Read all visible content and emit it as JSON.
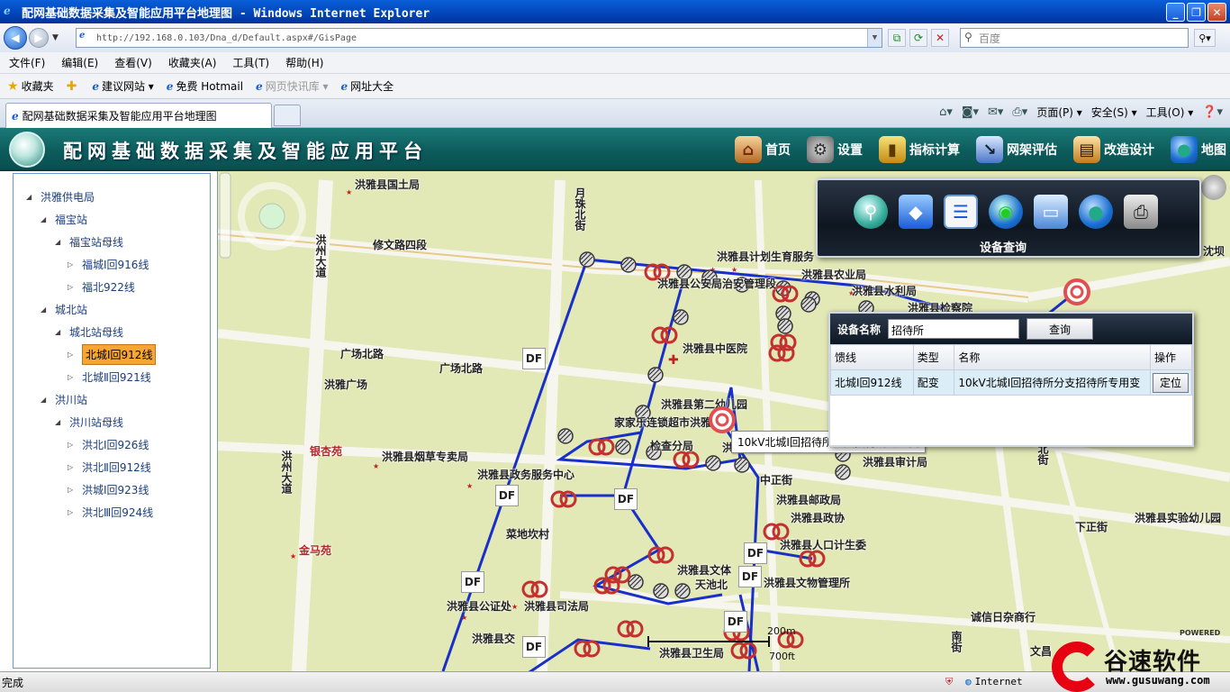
{
  "browser": {
    "title": "配网基础数据采集及智能应用平台地理图 - Windows Internet Explorer",
    "url": "http://192.168.0.103/Dna_d/Default.aspx#/GisPage",
    "search_placeholder": "百度",
    "menu": [
      "文件(F)",
      "编辑(E)",
      "查看(V)",
      "收藏夹(A)",
      "工具(T)",
      "帮助(H)"
    ],
    "favorites": {
      "label": "收藏夹",
      "items": [
        "建议网站 ▾",
        "免费 Hotmail",
        "网页快讯库 ▾",
        "网址大全"
      ]
    },
    "tab_title": "配网基础数据采集及智能应用平台地理图",
    "commands": [
      "页面(P) ▾",
      "安全(S) ▾",
      "工具(O) ▾"
    ],
    "status": "完成",
    "zone": "Internet"
  },
  "app": {
    "title": "配网基础数据采集及智能应用平台",
    "nav": [
      {
        "label": "首页",
        "icon": "home-icon"
      },
      {
        "label": "设置",
        "icon": "gear-icon"
      },
      {
        "label": "指标计算",
        "icon": "calculator-icon"
      },
      {
        "label": "网架评估",
        "icon": "chart-icon"
      },
      {
        "label": "改造设计",
        "icon": "design-icon"
      },
      {
        "label": "地图",
        "icon": "globe-icon"
      }
    ]
  },
  "tree": [
    {
      "label": "洪雅供电局",
      "level": 0,
      "expanded": true
    },
    {
      "label": "福宝站",
      "level": 1,
      "expanded": true
    },
    {
      "label": "福宝站母线",
      "level": 2,
      "expanded": true
    },
    {
      "label": "福城Ⅰ回916线",
      "level": 3
    },
    {
      "label": "福北922线",
      "level": 3
    },
    {
      "label": "城北站",
      "level": 1,
      "expanded": true
    },
    {
      "label": "城北站母线",
      "level": 2,
      "expanded": true
    },
    {
      "label": "北城Ⅰ回912线",
      "level": 3,
      "selected": true
    },
    {
      "label": "北城Ⅱ回921线",
      "level": 3
    },
    {
      "label": "洪川站",
      "level": 1,
      "expanded": true
    },
    {
      "label": "洪川站母线",
      "level": 2,
      "expanded": true
    },
    {
      "label": "洪北Ⅰ回926线",
      "level": 3
    },
    {
      "label": "洪北Ⅱ回912线",
      "level": 3
    },
    {
      "label": "洪城Ⅰ回923线",
      "level": 3
    },
    {
      "label": "洪北Ⅲ回924线",
      "level": 3
    }
  ],
  "map": {
    "labels": [
      {
        "text": "洪雅县国土局"
      },
      {
        "text": "修文路四段"
      },
      {
        "text": "月珠北街"
      },
      {
        "text": "洪州大道"
      },
      {
        "text": "洪雅县计划生育服务"
      },
      {
        "text": "洪雅县农业局"
      },
      {
        "text": "洪雅县水利局"
      },
      {
        "text": "洪雅县检察院"
      },
      {
        "text": "洪雅县中医院"
      },
      {
        "text": "广场北路"
      },
      {
        "text": "广场北路"
      },
      {
        "text": "洪雅广场"
      },
      {
        "text": "洪雅县第二幼儿园"
      },
      {
        "text": "家家乐连锁超市洪雅"
      },
      {
        "text": "银杏苑",
        "red": true
      },
      {
        "text": "洪雅县烟草专卖局"
      },
      {
        "text": "洪雅县政务服务中心"
      },
      {
        "text": "洪州大道"
      },
      {
        "text": "中正街"
      },
      {
        "text": "洪雅县邮政局"
      },
      {
        "text": "洪雅县政协"
      },
      {
        "text": "洪雅县审计局"
      },
      {
        "text": "下正街"
      },
      {
        "text": "洪雅县实验幼儿园"
      },
      {
        "text": "菜地坎村"
      },
      {
        "text": "金马苑",
        "red": true
      },
      {
        "text": "洪雅县人口计生委"
      },
      {
        "text": "洪雅县文体"
      },
      {
        "text": "洪雅县文物管理所"
      },
      {
        "text": "天池北"
      },
      {
        "text": "洪雅县公证处"
      },
      {
        "text": "洪雅县司法局"
      },
      {
        "text": "诚信日杂商行"
      },
      {
        "text": "洪雅县交"
      },
      {
        "text": "洪雅县卫生局"
      },
      {
        "text": "洪雅县"
      },
      {
        "text": "检查分局"
      },
      {
        "text": "洪雅县公安局治安管理段"
      },
      {
        "text": "沈坝"
      },
      {
        "text": "南街"
      },
      {
        "text": "文昌"
      },
      {
        "text": "北街"
      }
    ],
    "df_label": "DF",
    "tooltip": "10kV北城Ⅰ回招待所分支招待所专用变",
    "scale": {
      "top": "200m",
      "bottom": "700ft"
    },
    "powered": "POWERED"
  },
  "tool_panel": {
    "caption": "设备查询",
    "icons": [
      "magnifier-icon",
      "cube-icon",
      "list-icon",
      "globe-search-icon",
      "monitor-icon",
      "globe-icon",
      "printer-icon"
    ]
  },
  "query": {
    "label": "设备名称",
    "value": "招待所",
    "button": "查询",
    "headers": [
      "馈线",
      "类型",
      "名称",
      "操作"
    ],
    "rows": [
      {
        "feeder": "北城Ⅰ回912线",
        "type": "配变",
        "name": "10kV北城Ⅰ回招待所分支招待所专用变",
        "action": "定位"
      }
    ]
  },
  "watermark": {
    "text": "谷速软件",
    "url": "www.gusuwang.com"
  },
  "colors": {
    "header": "#0d5c5c",
    "line": "#1830c8",
    "selected": "#f7a533",
    "transformer": "#c43030"
  }
}
